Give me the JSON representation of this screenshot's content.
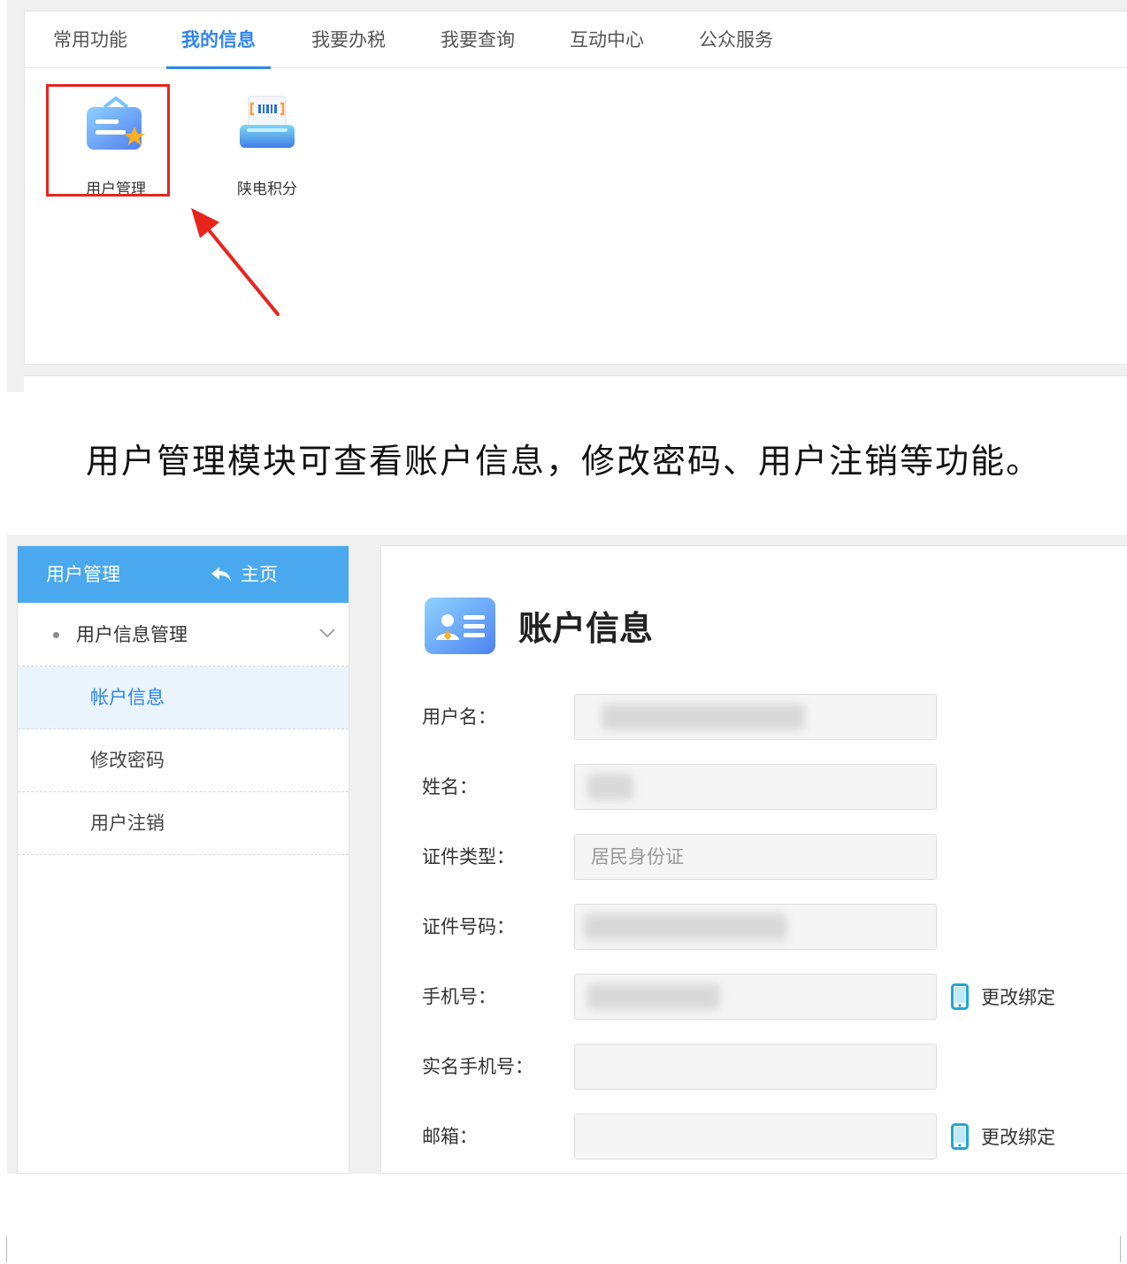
{
  "top_panel": {
    "tabs": [
      "常用功能",
      "我的信息",
      "我要办税",
      "我要查询",
      "互动中心",
      "公众服务"
    ],
    "active_tab_index": 1,
    "apps": [
      {
        "label": "用户管理",
        "icon": "user-card-star-icon",
        "highlighted": true
      },
      {
        "label": "陕电积分",
        "icon": "barcode-printer-icon",
        "highlighted": false
      }
    ],
    "annotation": "red-arrow-pointing-to-user-management"
  },
  "caption": "用户管理模块可查看账户信息，修改密码、用户注销等功能。",
  "bottom_panel": {
    "sidebar": {
      "header_title": "用户管理",
      "home_label": "主页",
      "group_label": "用户信息管理",
      "items": [
        {
          "label": "帐户信息",
          "active": true
        },
        {
          "label": "修改密码",
          "active": false
        },
        {
          "label": "用户注销",
          "active": false
        }
      ]
    },
    "main": {
      "title": "账户信息",
      "fields": [
        {
          "label": "用户名：",
          "value": "",
          "blurred": true
        },
        {
          "label": "姓名：",
          "value": "",
          "blurred": true
        },
        {
          "label": "证件类型：",
          "value": "居民身份证",
          "blurred": false
        },
        {
          "label": "证件号码：",
          "value": "",
          "blurred": true
        },
        {
          "label": "手机号：",
          "value": "",
          "blurred": true,
          "action": "更改绑定"
        },
        {
          "label": "实名手机号：",
          "value": "",
          "blurred": false
        },
        {
          "label": "邮箱：",
          "value": "",
          "blurred": false,
          "action": "更改绑定"
        }
      ]
    }
  },
  "colors": {
    "accent": "#2f86e8",
    "sidebar_header": "#4aa8ee",
    "highlight_red": "#e8251d",
    "phone_icon": "#1fa6d6"
  }
}
